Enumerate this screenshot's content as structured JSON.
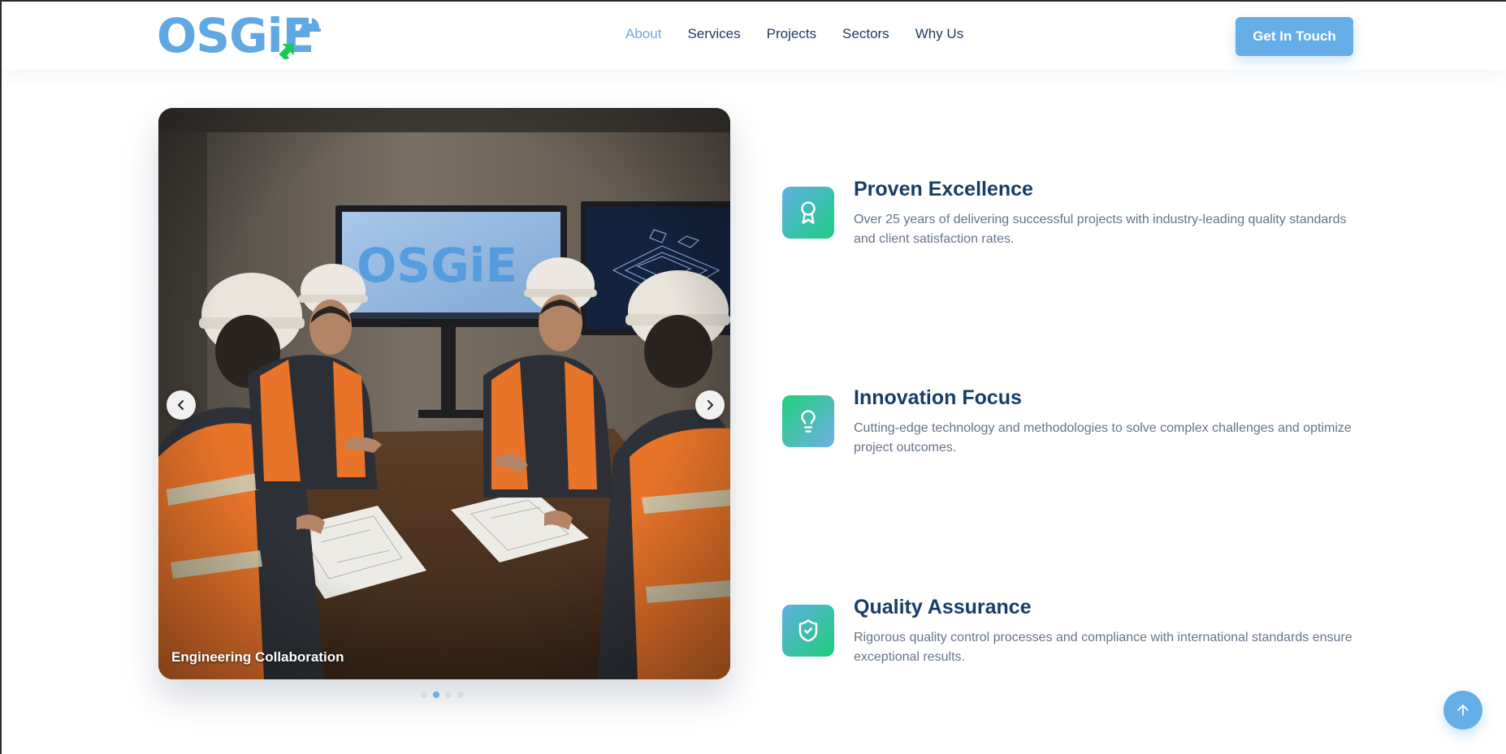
{
  "brand": {
    "logo_text": "OSGiE",
    "primary_color": "#5fa8e3",
    "accent_color": "#17c95a",
    "dark_color": "#173d66"
  },
  "nav": {
    "items": [
      {
        "label": "About",
        "active": true
      },
      {
        "label": "Services",
        "active": false
      },
      {
        "label": "Projects",
        "active": false
      },
      {
        "label": "Sectors",
        "active": false
      },
      {
        "label": "Why Us",
        "active": false
      }
    ],
    "cta_label": "Get In Touch"
  },
  "carousel": {
    "caption": "Engineering Collaboration",
    "slide_count": 4,
    "active_index": 1,
    "prev_icon": "chevron-left-icon",
    "next_icon": "chevron-right-icon"
  },
  "features": [
    {
      "title": "Proven Excellence",
      "description": "Over 25 years of delivering successful projects with industry-leading quality standards and client satisfaction rates.",
      "icon": "award-icon"
    },
    {
      "title": "Innovation Focus",
      "description": "Cutting-edge technology and methodologies to solve complex challenges and optimize project outcomes.",
      "icon": "lightbulb-icon"
    },
    {
      "title": "Quality Assurance",
      "description": "Rigorous quality control processes and compliance with international standards ensure exceptional results.",
      "icon": "shield-check-icon"
    }
  ],
  "scroll_top": {
    "icon": "arrow-up-icon"
  }
}
